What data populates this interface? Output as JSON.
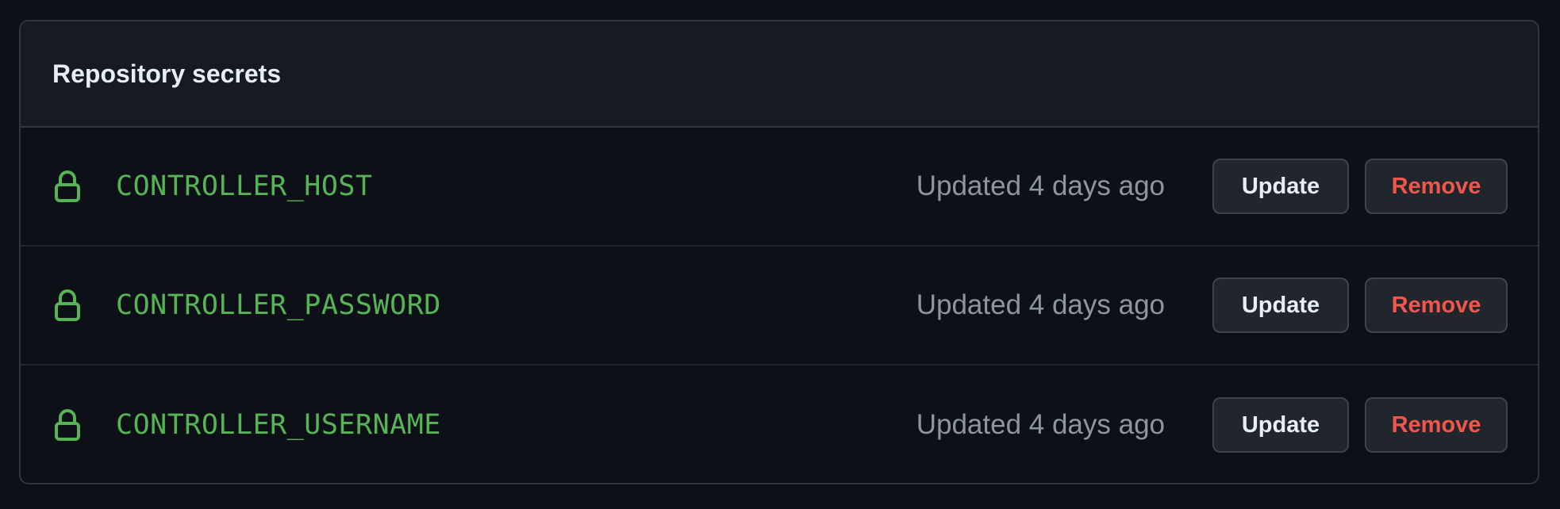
{
  "panel": {
    "title": "Repository secrets"
  },
  "secrets": [
    {
      "name": "CONTROLLER_HOST",
      "updated": "Updated 4 days ago",
      "update_label": "Update",
      "remove_label": "Remove"
    },
    {
      "name": "CONTROLLER_PASSWORD",
      "updated": "Updated 4 days ago",
      "update_label": "Update",
      "remove_label": "Remove"
    },
    {
      "name": "CONTROLLER_USERNAME",
      "updated": "Updated 4 days ago",
      "update_label": "Update",
      "remove_label": "Remove"
    }
  ],
  "icons": {
    "secret": "lock-icon"
  },
  "colors": {
    "background": "#0d1117",
    "header_background": "#161b22",
    "secret_name": "#56b356",
    "remove_text": "#f0564c",
    "muted_text": "#8d96a0"
  }
}
